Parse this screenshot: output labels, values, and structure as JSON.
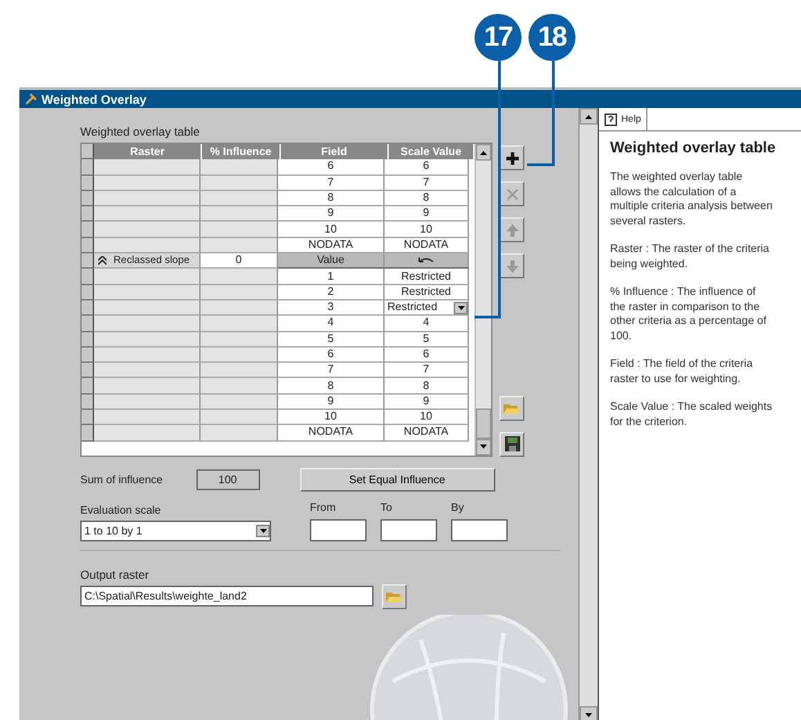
{
  "callouts": [
    {
      "label": "17"
    },
    {
      "label": "18"
    }
  ],
  "window": {
    "title": "Weighted Overlay"
  },
  "table": {
    "label": "Weighted overlay table",
    "columns": [
      "Raster",
      "% Influence",
      "Field",
      "Scale Value"
    ],
    "rows": [
      {
        "kind": "class",
        "field": "6",
        "scale": "6"
      },
      {
        "kind": "class",
        "field": "7",
        "scale": "7"
      },
      {
        "kind": "class",
        "field": "8",
        "scale": "8"
      },
      {
        "kind": "class",
        "field": "9",
        "scale": "9"
      },
      {
        "kind": "class",
        "field": "10",
        "scale": "10"
      },
      {
        "kind": "class",
        "field": "NODATA",
        "scale": "NODATA"
      },
      {
        "kind": "raster",
        "raster": "Reclassed slope",
        "influence": "0",
        "field": "Value"
      },
      {
        "kind": "class",
        "field": "1",
        "scale": "Restricted"
      },
      {
        "kind": "class",
        "field": "2",
        "scale": "Restricted"
      },
      {
        "kind": "select",
        "field": "3",
        "scale": "Restricted"
      },
      {
        "kind": "class",
        "field": "4",
        "scale": "4"
      },
      {
        "kind": "class",
        "field": "5",
        "scale": "5"
      },
      {
        "kind": "class",
        "field": "6",
        "scale": "6"
      },
      {
        "kind": "class",
        "field": "7",
        "scale": "7"
      },
      {
        "kind": "class",
        "field": "8",
        "scale": "8"
      },
      {
        "kind": "class",
        "field": "9",
        "scale": "9"
      },
      {
        "kind": "class",
        "field": "10",
        "scale": "10"
      },
      {
        "kind": "class",
        "field": "NODATA",
        "scale": "NODATA"
      }
    ]
  },
  "tools": [
    {
      "kind": "add",
      "disabled": false
    },
    {
      "kind": "remove",
      "disabled": true
    },
    {
      "kind": "up",
      "disabled": true
    },
    {
      "kind": "down",
      "disabled": true
    }
  ],
  "sum": {
    "label": "Sum of influence",
    "value": "100"
  },
  "equal_button": "Set Equal Influence",
  "evaluation_scale": {
    "label": "Evaluation scale",
    "value": "1 to 10 by 1"
  },
  "range": [
    {
      "label": "From"
    },
    {
      "label": "To"
    },
    {
      "label": "By"
    }
  ],
  "output": {
    "label": "Output raster",
    "value": "C:\\Spatial\\Results\\weighte_land2"
  },
  "help": {
    "tab": "Help",
    "title": "Weighted overlay table",
    "paragraphs": [
      "The weighted overlay table allows the calculation of a multiple criteria analysis between several rasters.",
      "Raster : The raster of the criteria being weighted.",
      "% Influence : The influence of the raster in comparison to the other criteria as a percentage of 100.",
      "Field : The field of the criteria raster to use for weighting.",
      "Scale Value : The scaled weights for the criterion."
    ]
  }
}
